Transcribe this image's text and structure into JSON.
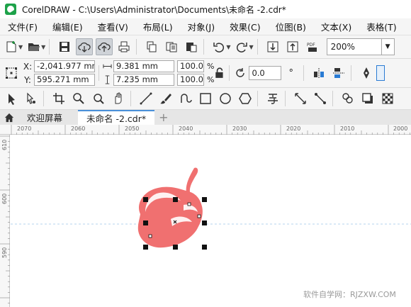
{
  "window": {
    "title": "CorelDRAW - C:\\Users\\Administrator\\Documents\\未命名 -2.cdr*"
  },
  "menu": [
    {
      "label": "文件(F)"
    },
    {
      "label": "编辑(E)"
    },
    {
      "label": "查看(V)"
    },
    {
      "label": "布局(L)"
    },
    {
      "label": "对象(J)"
    },
    {
      "label": "效果(C)"
    },
    {
      "label": "位图(B)"
    },
    {
      "label": "文本(X)"
    },
    {
      "label": "表格(T)"
    }
  ],
  "toolbar": {
    "zoom": "200%",
    "pdf_label": "PDF"
  },
  "properties": {
    "x_label": "X:",
    "y_label": "Y:",
    "x": "-2,041.977 mm",
    "y": "595.271 mm",
    "width": "9.381 mm",
    "height": "7.235 mm",
    "scale_x": "100.0",
    "scale_y": "100.0",
    "pct": "%",
    "rotation": "0.0",
    "degree": "°"
  },
  "tabs": {
    "welcome": "欢迎屏幕",
    "document": "未命名 -2.cdr*",
    "add": "+"
  },
  "ruler": {
    "h_labels": [
      "2070",
      "2060",
      "2050",
      "2040",
      "2030",
      "2020",
      "2010",
      "2000"
    ],
    "v_labels": [
      "610",
      "600",
      "590"
    ]
  },
  "colors": {
    "shape_fill": "#f07070",
    "accent": "#4a90d9"
  },
  "watermark": "软件自学网：RJZXW.COM"
}
